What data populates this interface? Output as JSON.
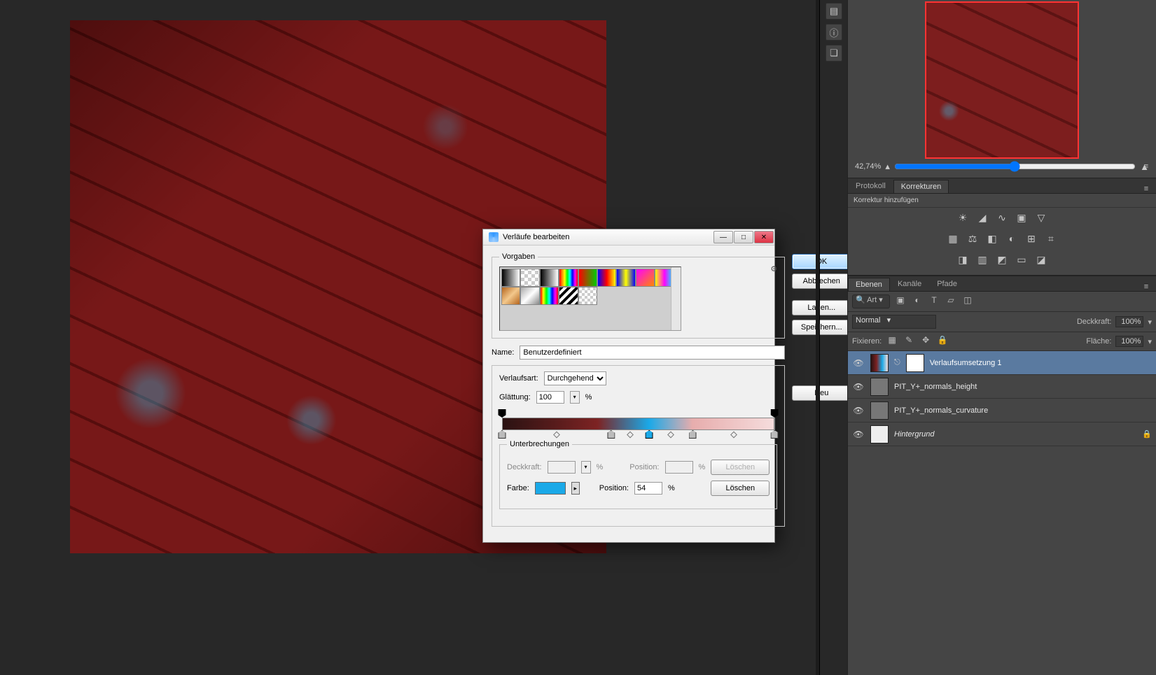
{
  "dialog": {
    "title": "Verläufe bearbeiten",
    "presets_label": "Vorgaben",
    "name_label": "Name:",
    "name_value": "Benutzerdefiniert",
    "type_label": "Verlaufsart:",
    "type_value": "Durchgehend",
    "smooth_label": "Glättung:",
    "smooth_value": "100",
    "smooth_unit": "%",
    "stops_label": "Unterbrechungen",
    "opacity_label": "Deckkraft:",
    "opacity_unit": "%",
    "position_label": "Position:",
    "position_unit": "%",
    "delete1": "Löschen",
    "color_label": "Farbe:",
    "color_value": "#1aa9e8",
    "position2_value": "54",
    "delete2": "Löschen",
    "buttons": {
      "ok": "OK",
      "cancel": "Abbrechen",
      "load": "Laden...",
      "save": "Speichern...",
      "neu": "Neu"
    },
    "gradient_stops": [
      {
        "pos": 0,
        "color": "#2a1212"
      },
      {
        "pos": 40,
        "color": "#7d2323"
      },
      {
        "pos": 54,
        "color": "#1aa9e8",
        "selected": true
      },
      {
        "pos": 70,
        "color": "#e7adad"
      },
      {
        "pos": 100,
        "color": "#f5dcdc"
      }
    ],
    "preset_swatches": [
      "linear-gradient(90deg,#000,#fff)",
      "repeating-conic-gradient(#ccc 0 25%,#fff 0 50%) 0/10px 10px, linear-gradient(90deg,#000,transparent)",
      "linear-gradient(90deg,#000,#fff)",
      "linear-gradient(90deg,#f00,#f80,#ff0,#0f0,#0ff,#00f,#f0f,#f00)",
      "linear-gradient(90deg,#f00,#0c0)",
      "linear-gradient(90deg,#00f,#f00,#ff0)",
      "linear-gradient(90deg,#00f,#ff0,#00f)",
      "linear-gradient(135deg,#f0f,#f80)",
      "linear-gradient(90deg,#ff0,#f0f,#0ff)",
      "linear-gradient(135deg,#b5651d,#f3c88c,#b5651d)",
      "linear-gradient(135deg,#aaa,#fff,#888)",
      "linear-gradient(90deg,#f00,#ff0,#0f0,#0ff,#00f,#f0f,#f00)",
      "repeating-linear-gradient(135deg,#000 0 4px,#fff 4px 8px)",
      "repeating-conic-gradient(#ccc 0 25%,#fff 0 50%) 0 / 8px 8px"
    ]
  },
  "navigator": {
    "zoom": "42,74%"
  },
  "adjustments": {
    "tab_protocol": "Protokoll",
    "tab_active": "Korrekturen",
    "subtitle": "Korrektur hinzufügen"
  },
  "layers_panel": {
    "tab_layers": "Ebenen",
    "tab_channels": "Kanäle",
    "tab_paths": "Pfade",
    "search": "Art",
    "blend": "Normal",
    "opacity_label": "Deckkraft:",
    "opacity_value": "100%",
    "lock_label": "Fixieren:",
    "fill_label": "Fläche:",
    "fill_value": "100%",
    "layers": [
      {
        "name": "Verlaufsumsetzung 1",
        "selected": true,
        "type": "adj"
      },
      {
        "name": "PIT_Y+_normals_height"
      },
      {
        "name": "PIT_Y+_normals_curvature"
      },
      {
        "name": "Hintergrund",
        "locked": true,
        "italic": true
      }
    ]
  }
}
